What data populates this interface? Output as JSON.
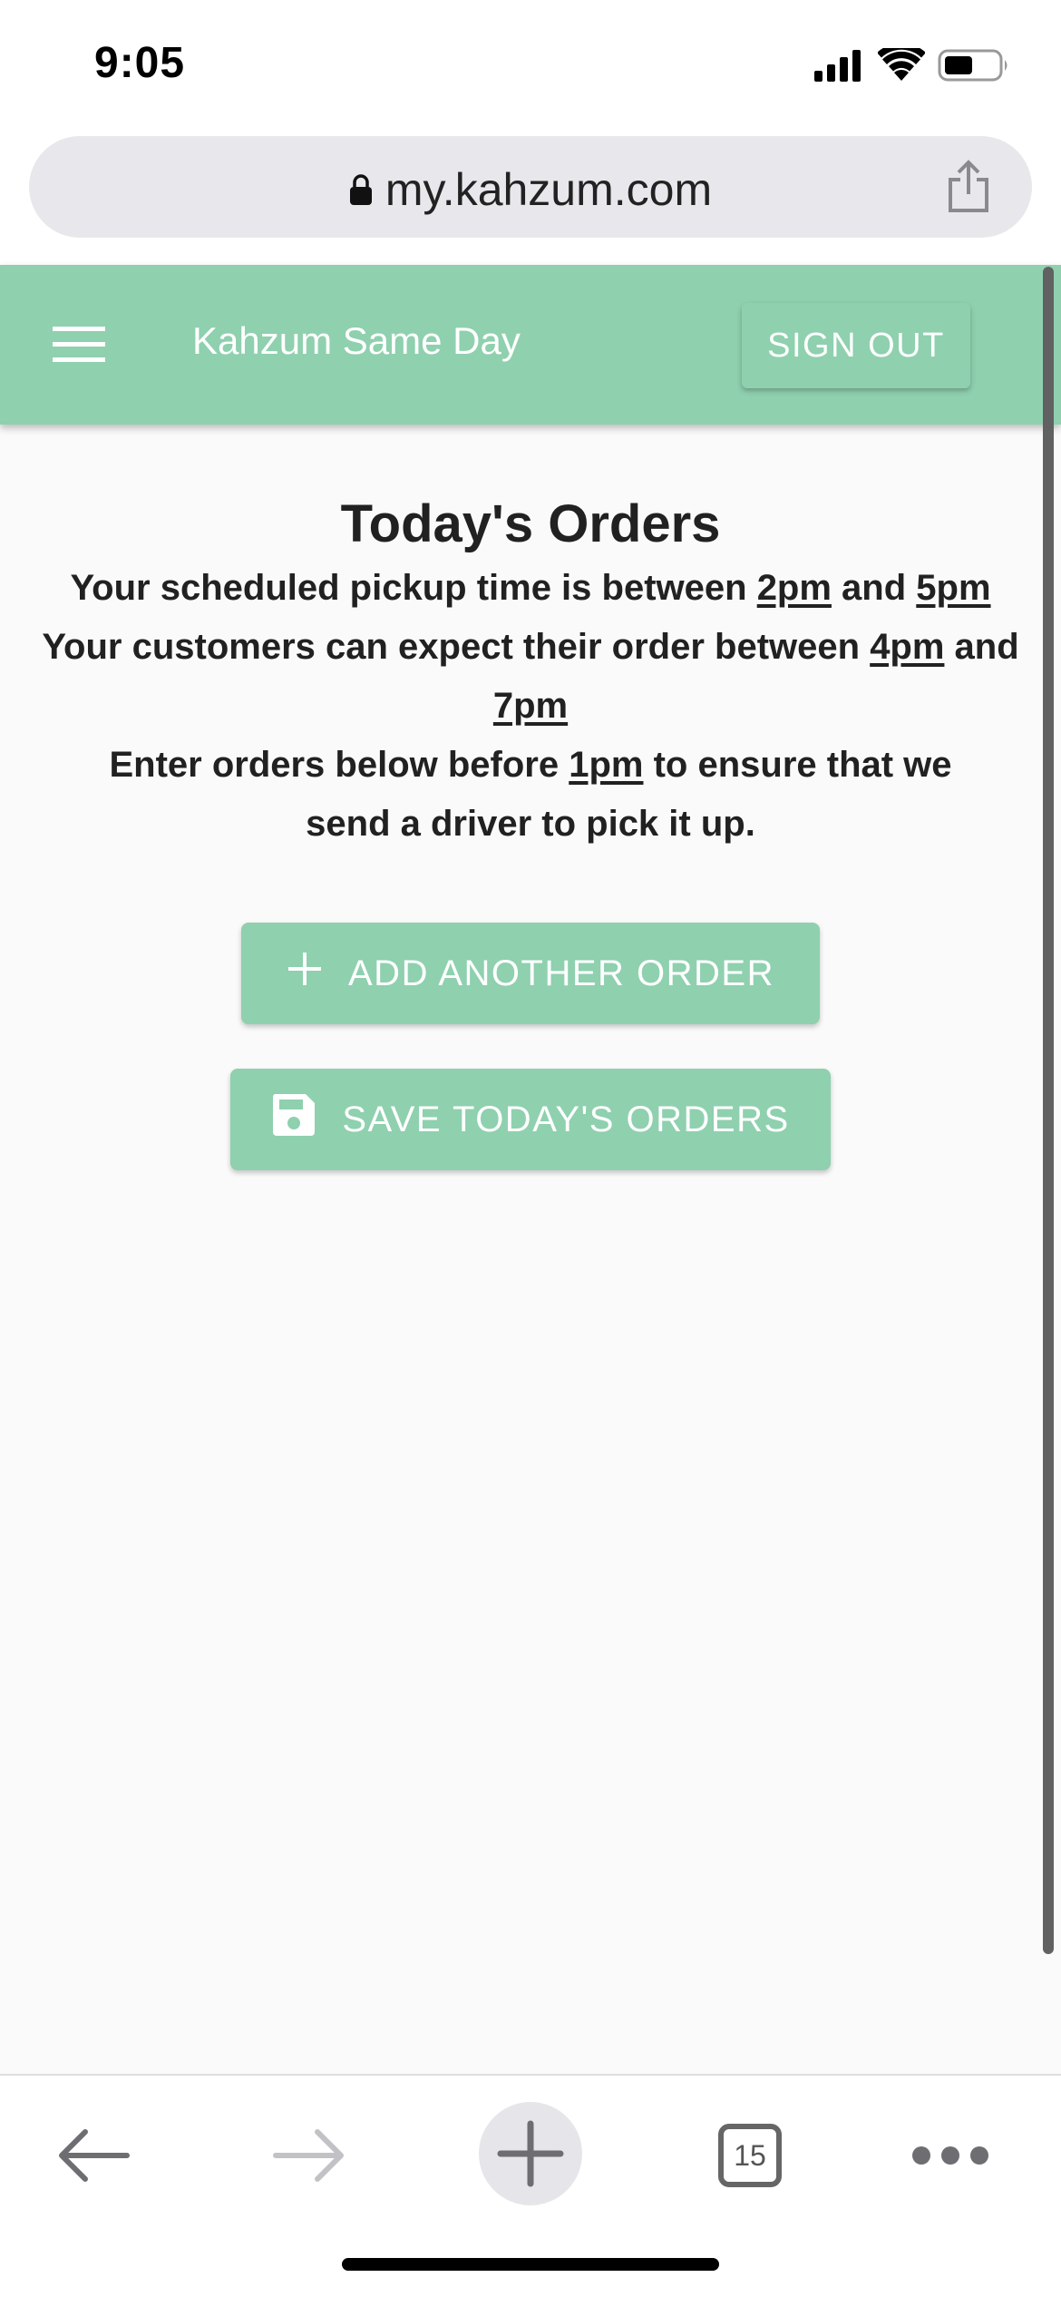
{
  "status_bar": {
    "time": "9:05"
  },
  "browser": {
    "url": "my.kahzum.com",
    "tab_count": "15"
  },
  "app_bar": {
    "title": "Kahzum Same Day",
    "sign_out_label": "SIGN OUT"
  },
  "main": {
    "title": "Today's Orders",
    "pickup": {
      "prefix": "Your scheduled pickup time is between ",
      "start": "2pm",
      "middle": " and ",
      "end": "5pm"
    },
    "delivery": {
      "prefix": "Your customers can expect their order between ",
      "start": "4pm",
      "middle": " and ",
      "end": "7pm"
    },
    "cutoff": {
      "prefix": "Enter orders below before ",
      "time": "1pm",
      "suffix": " to ensure that we send a driver to pick it up."
    },
    "add_button_label": "ADD ANOTHER ORDER",
    "save_button_label": "SAVE TODAY'S ORDERS"
  },
  "colors": {
    "accent": "#8fd0af",
    "text": "#212121",
    "background": "#fafafa"
  },
  "icons": {
    "menu": "hamburger-menu-icon",
    "add": "plus-icon",
    "save": "floppy-disk-icon",
    "lock": "lock-icon",
    "share": "share-icon"
  }
}
